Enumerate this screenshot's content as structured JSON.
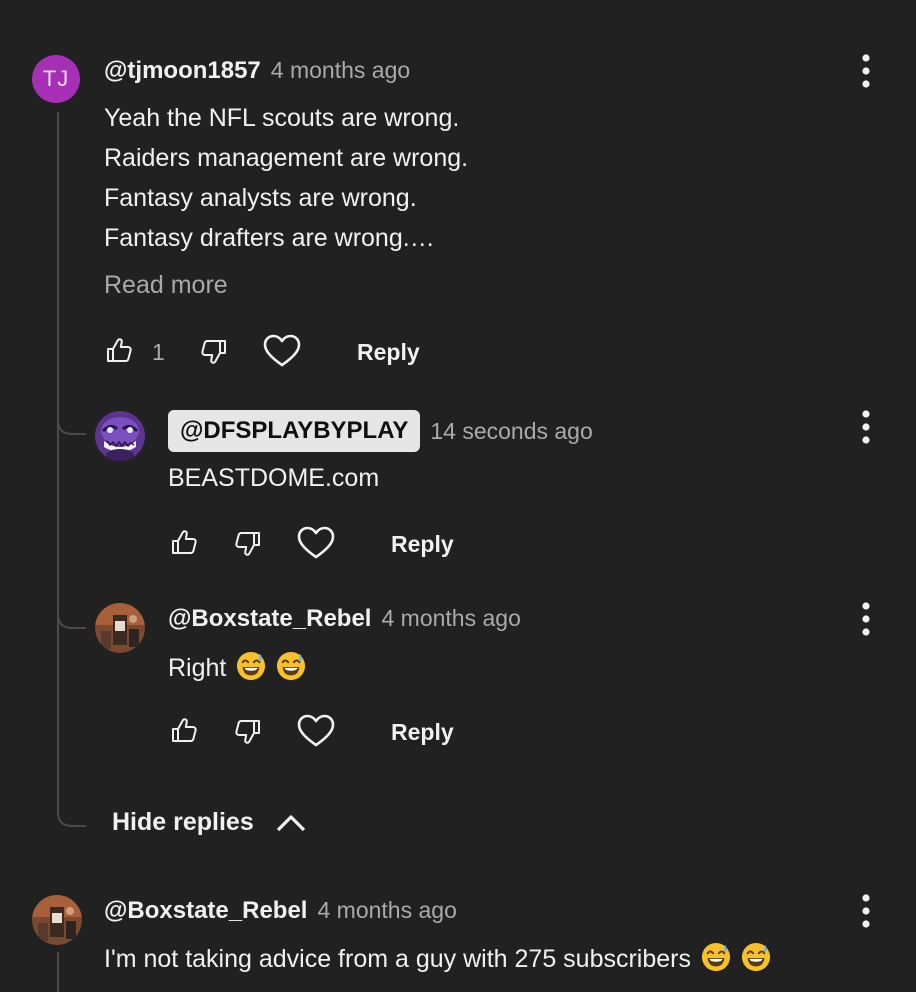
{
  "colors": {
    "background": "#212121",
    "text": "#f1f1f1",
    "muted": "#aaaaaa",
    "avatar_tj": "#a530b5",
    "owner_chip_bg": "#e6e6e6",
    "owner_avatar": "#6a3c9a"
  },
  "comments": [
    {
      "avatar_text": "TJ",
      "handle": "@tjmoon1857",
      "time": "4 months ago",
      "lines": [
        "Yeah the NFL scouts are wrong.",
        "Raiders management are wrong.",
        "Fantasy analysts are wrong.",
        "Fantasy drafters are wrong.…"
      ],
      "read_more": "Read more",
      "likes": "1",
      "reply_label": "Reply",
      "replies": [
        {
          "handle": "@DFSPLAYBYPLAY",
          "is_owner": true,
          "time": "14 seconds ago",
          "text": "BEASTDOME.com",
          "reply_label": "Reply",
          "avatar_icon": "purple-monster-avatar"
        },
        {
          "handle": "@Boxstate_Rebel",
          "time": "4 months ago",
          "text": "Right",
          "emojis": [
            "grinning-sweat-emoji",
            "grinning-sweat-emoji"
          ],
          "reply_label": "Reply",
          "avatar_icon": "photo-avatar"
        }
      ],
      "hide_replies_label": "Hide replies"
    },
    {
      "handle": "@Boxstate_Rebel",
      "time": "4 months ago",
      "text": "I'm not taking advice from a guy with 275 subscribers",
      "emojis": [
        "grinning-sweat-emoji",
        "grinning-sweat-emoji"
      ],
      "avatar_icon": "photo-avatar"
    }
  ],
  "icons": {
    "like": "thumbs-up-icon",
    "dislike": "thumbs-down-icon",
    "heart": "heart-icon",
    "more": "more-vert-icon",
    "chevron": "chevron-up-icon"
  }
}
